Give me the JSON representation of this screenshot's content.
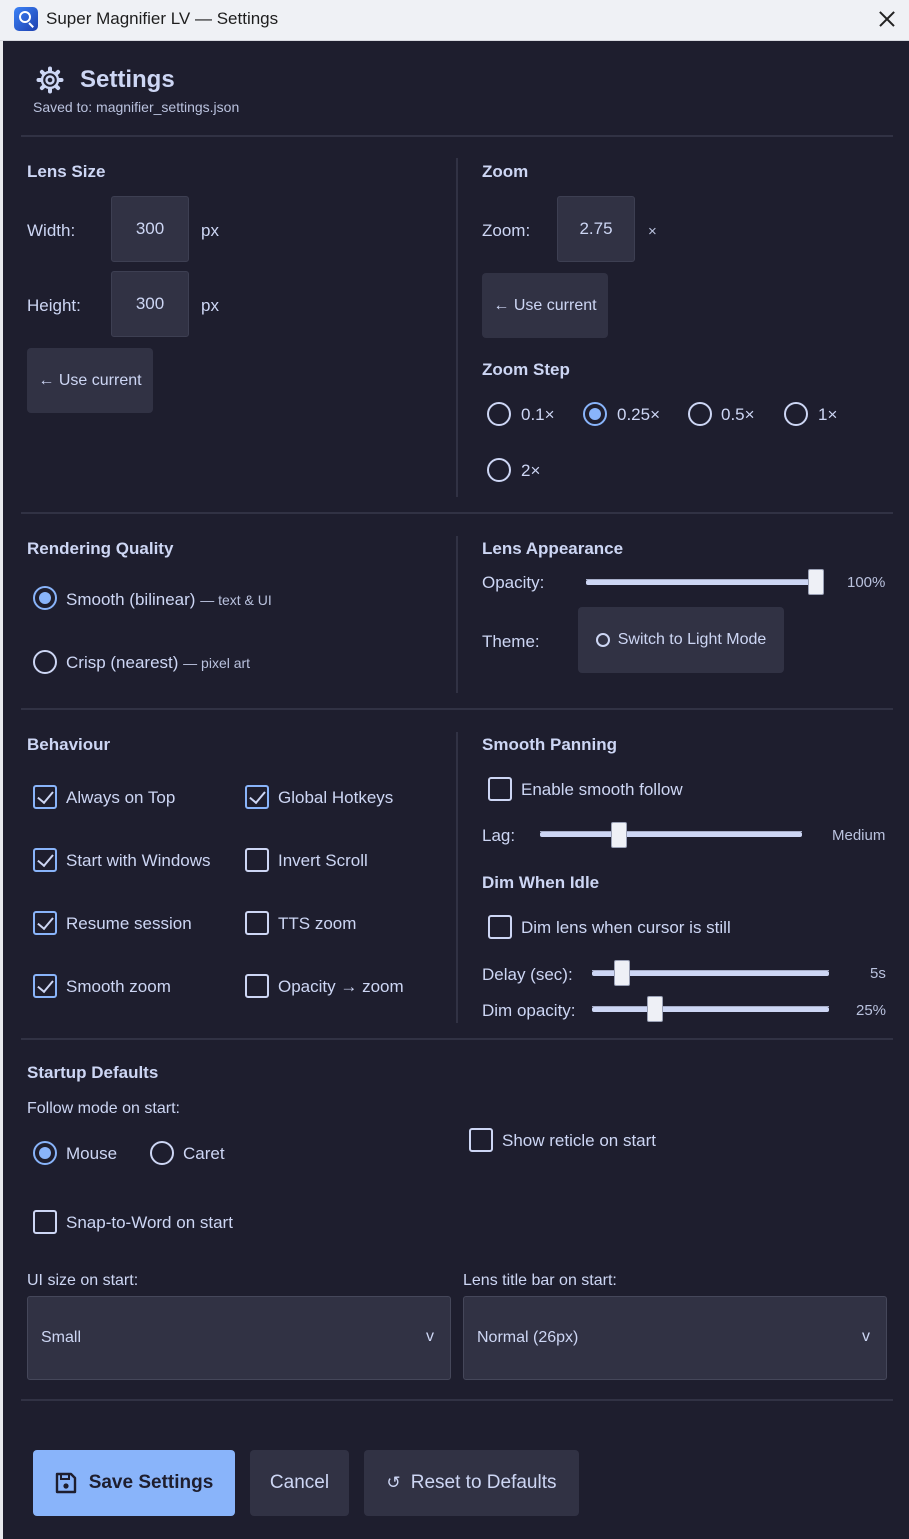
{
  "window": {
    "title": "Super Magnifier LV — Settings"
  },
  "header": {
    "title": "Settings",
    "saved_to": "Saved to: magnifier_settings.json"
  },
  "lens_size": {
    "title": "Lens Size",
    "width_label": "Width:",
    "width_value": "300",
    "width_unit": "px",
    "height_label": "Height:",
    "height_value": "300",
    "height_unit": "px",
    "use_current": "← Use current"
  },
  "zoom": {
    "title": "Zoom",
    "zoom_label": "Zoom:",
    "zoom_value": "2.75",
    "zoom_unit": "×",
    "use_current": "← Use current",
    "step_title": "Zoom Step",
    "steps": [
      "0.1×",
      "0.25×",
      "0.5×",
      "1×",
      "2×"
    ],
    "selected_step": "0.25×"
  },
  "rendering": {
    "title": "Rendering Quality",
    "smooth_label": "Smooth (bilinear)",
    "smooth_hint": "— text & UI",
    "crisp_label": "Crisp (nearest)",
    "crisp_hint": "— pixel art",
    "selected": "Smooth (bilinear)"
  },
  "appearance": {
    "title": "Lens Appearance",
    "opacity_label": "Opacity:",
    "opacity_value": "100%",
    "opacity_fraction": 1.0,
    "theme_label": "Theme:",
    "theme_button": "Switch to Light Mode"
  },
  "behaviour": {
    "title": "Behaviour",
    "items": [
      {
        "label": "Always on Top",
        "checked": true
      },
      {
        "label": "Global Hotkeys",
        "checked": true
      },
      {
        "label": "Start with Windows",
        "checked": true
      },
      {
        "label": "Invert Scroll",
        "checked": false
      },
      {
        "label": "Resume session",
        "checked": true
      },
      {
        "label": "TTS zoom",
        "checked": false
      },
      {
        "label": "Smooth zoom",
        "checked": true
      },
      {
        "label": "Opacity → zoom",
        "checked": false
      }
    ]
  },
  "smooth_panning": {
    "title": "Smooth Panning",
    "enable_label": "Enable smooth follow",
    "enable_checked": false,
    "lag_label": "Lag:",
    "lag_value": "Medium",
    "lag_fraction": 0.29
  },
  "dim_idle": {
    "title": "Dim When Idle",
    "dim_label": "Dim lens when cursor is still",
    "dim_checked": false,
    "delay_label": "Delay (sec):",
    "delay_value": "5s",
    "delay_fraction": 0.1,
    "dim_opacity_label": "Dim opacity:",
    "dim_opacity_value": "25%",
    "dim_opacity_fraction": 0.25
  },
  "startup": {
    "title": "Startup Defaults",
    "follow_label": "Follow mode on start:",
    "follow_options": [
      "Mouse",
      "Caret"
    ],
    "follow_selected": "Mouse",
    "reticle_label": "Show reticle on start",
    "reticle_checked": false,
    "snap_label": "Snap-to-Word on start",
    "snap_checked": false,
    "ui_size_label": "UI size on start:",
    "ui_size_value": "Small",
    "title_bar_label": "Lens title bar on start:",
    "title_bar_value": "Normal (26px)"
  },
  "footer": {
    "save": "Save Settings",
    "cancel": "Cancel",
    "reset": "Reset to Defaults"
  },
  "colors": {
    "background": "#1e1e2e",
    "accent": "#89b4fa",
    "surface": "#313244",
    "text": "#cdd6f4"
  },
  "icons": [
    "magnifier-app-icon",
    "close-icon",
    "gear-icon",
    "theme-toggle-icon",
    "floppy-disk-icon",
    "reset-icon",
    "chevron-down-icon"
  ]
}
